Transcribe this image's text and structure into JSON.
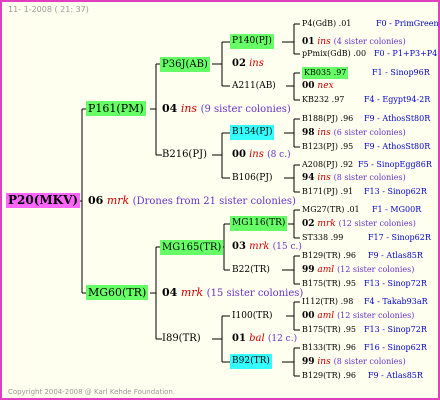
{
  "header": "11- 1-2008 ( 21: 37)",
  "footer": "Copyright 2004-2008 @ Karl Kehde Foundation.",
  "colors": {
    "green": "#66ff66",
    "cyan": "#33ffff",
    "magenta": "#ff66ff",
    "border": "#e040c0"
  },
  "gen1": {
    "label": "P20(MKV)"
  },
  "gen2": [
    {
      "label": "P161(PM)",
      "year": "04",
      "line": "ins",
      "note": "(9 sister colonies)"
    },
    {
      "center_year": "06",
      "center_line": "mrk",
      "center_note": "(Drones from 21 sister colonies)"
    },
    {
      "label": "MG60(TR)",
      "year": "04",
      "line": "mrk",
      "note": "(15 sister colonies)"
    }
  ],
  "gen3": [
    {
      "label": "P36J(AB)",
      "year": "02",
      "line": "ins"
    },
    {
      "label": "B216(PJ)",
      "year": "00",
      "line": "ins",
      "note": "(8 c.)"
    },
    {
      "label": "MG165(TR)",
      "year": "03",
      "line": "mrk",
      "note": "(15 c.)"
    },
    {
      "label": "I89(TR)",
      "year": "01",
      "line": "bal",
      "note": "(12 c.)"
    }
  ],
  "gen4": [
    {
      "label": "P140(PJ)",
      "year": "01",
      "line": "ins",
      "note": "(4 sister colonies)"
    },
    {
      "label": "A211(AB)",
      "year": "00",
      "line": "nex"
    },
    {
      "label": "B134(PJ)",
      "year": "98",
      "line": "ins",
      "note": "(6 sister colonies)"
    },
    {
      "label": "B106(PJ)",
      "year": "94",
      "line": "ins",
      "note": "(8 sister colonies)"
    },
    {
      "label": "MG116(TR)",
      "year": "02",
      "line": "mrk",
      "note": "(12 sister colonies)"
    },
    {
      "label": "B22(TR)",
      "year": "99",
      "line": "aml",
      "note": "(12 sister colonies)"
    },
    {
      "label": "I100(TR)",
      "year": "00",
      "line": "aml",
      "note": "(12 sister colonies)"
    },
    {
      "label": "B92(TR)",
      "year": "99",
      "line": "ins",
      "note": "(8 sister colonies)"
    }
  ],
  "leaves": [
    {
      "name": "P4(GdB) .01",
      "loc": "F0 - PrimGreen00"
    },
    {
      "name": "pPmix(GdB) .00",
      "loc": "F0 - P1+P3+P4"
    },
    {
      "name": "KB035 .97",
      "loc": "F1 - Sinop96R"
    },
    {
      "name": "KB232 .97",
      "loc": "F4 - Egypt94-2R"
    },
    {
      "name": "B188(PJ) .96",
      "loc": "F9 - AthosSt80R"
    },
    {
      "name": "B123(PJ) .95",
      "loc": "F9 - AthosSt80R"
    },
    {
      "name": "A208(PJ) .92",
      "loc": "F5 - SinopEgg86R"
    },
    {
      "name": "B171(PJ) .91",
      "loc": "F13 - Sinop62R"
    },
    {
      "name": "MG27(TR) .01",
      "loc": "F1 - MG00R"
    },
    {
      "name": "ST338 .99",
      "loc": "F17 - Sinop62R"
    },
    {
      "name": "B129(TR) .96",
      "loc": "F9 - Atlas85R"
    },
    {
      "name": "B175(TR) .95",
      "loc": "F13 - Sinop72R"
    },
    {
      "name": "I112(TR) .98",
      "loc": "F4 - Takab93aR"
    },
    {
      "name": "B175(TR) .95",
      "loc": "F13 - Sinop72R"
    },
    {
      "name": "B133(TR) .96",
      "loc": "F16 - Sinop62R"
    },
    {
      "name": "B129(TR) .96",
      "loc": "F9 - Atlas85R"
    }
  ]
}
